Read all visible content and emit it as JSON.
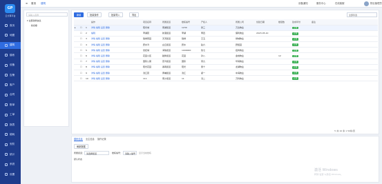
{
  "app": {
    "logo": "GP",
    "logo_text": "云计算平台"
  },
  "nav": [
    "首页",
    "地图",
    "建筑",
    "楼栋",
    "设备",
    "告警",
    "客户",
    "合同",
    "账单",
    "工单",
    "报表",
    "能耗",
    "安防",
    "统计",
    "系统",
    "设置"
  ],
  "nav_active": 2,
  "topbar": {
    "tabs": [
      "首页",
      "建筑"
    ],
    "links": [
      "设备通知",
      "服务中心",
      "在线客服"
    ],
    "user": "物业管理员"
  },
  "tree": {
    "search_placeholder": "请输入名称",
    "nodes": [
      "▾ 全部建筑信息",
      "  · 综合楼"
    ]
  },
  "toolbar": {
    "new": "新增",
    "batch": "批量操作",
    "import": "批量导入",
    "export": "导出",
    "filter": "全部筛选"
  },
  "table": {
    "headers": [
      "",
      "",
      "",
      "操作",
      "项目名称",
      "所属街道",
      "楼栋编号",
      "产权人",
      "所属公司",
      "创建日期",
      "楼层数",
      "建成年份",
      "备注"
    ],
    "rows": [
      {
        "ops": "详情  编辑  设置  删除",
        "name": "阳光城",
        "street": "南湖街道",
        "code": "1230",
        "owner": "张三",
        "company": "万达物业",
        "date": "",
        "floors": "",
        "year": "",
        "status": "正常"
      },
      {
        "ops": "编辑",
        "name": "翠湖苑",
        "street": "新港街道",
        "code": "翠湖",
        "owner": "李四",
        "company": "保利物业",
        "date": "2023-05-10",
        "floors": "",
        "year": "",
        "status": "正常"
      },
      {
        "ops": "详情  编辑  设置  删除",
        "name": "锦绣家园",
        "street": "天河街道",
        "code": "锦绣",
        "owner": "王五",
        "company": "绿城物业",
        "date": "",
        "floors": "",
        "year": "",
        "status": "正常"
      },
      {
        "ops": "详情  编辑  设置  删除",
        "name": "碧水湾",
        "street": "白云街道",
        "code": "碧水",
        "owner": "赵六",
        "company": "碧桂园",
        "date": "",
        "floors": "",
        "year": "",
        "status": "正常"
      },
      {
        "ops": "详情  编辑  设置  删除",
        "name": "世纪城",
        "street": "海珠街道",
        "code": "1000000",
        "owner": "钱七",
        "company": "招商物业",
        "date": "",
        "floors": "",
        "year": "",
        "status": "正常"
      },
      {
        "ops": "详情  编辑  设置  删除",
        "name": "花园小区",
        "street": "越秀街道",
        "code": "花园",
        "owner": "孙八",
        "company": "金地物业",
        "date": "",
        "floors": "12",
        "year": "",
        "status": "正常"
      },
      {
        "ops": "详情  编辑  设置  删除",
        "name": "国际公寓",
        "street": "荔湾街道",
        "code": "国际",
        "owner": "周九",
        "company": "华润物业",
        "date": "",
        "floors": "",
        "year": "",
        "status": "正常"
      },
      {
        "ops": "详情  编辑  设置  删除",
        "name": "阳光花园",
        "street": "番禺街道",
        "code": "阳光",
        "owner": "吴十",
        "company": "龙湖物业",
        "date": "",
        "floors": "",
        "year": "",
        "status": "正常"
      },
      {
        "ops": "详情  编辑  设置  删除",
        "name": "滨江苑",
        "street": "黄埔街道",
        "code": "滨江",
        "owner": "郑一",
        "company": "中海物业",
        "date": "",
        "floors": "",
        "year": "",
        "status": "正常"
      },
      {
        "ops": "详情  编辑  设置  删除",
        "name": "111",
        "street": "南沙街道",
        "code": "11",
        "owner": "冯二",
        "company": "万科物业",
        "date": "",
        "floors": "",
        "year": "",
        "status": "正常"
      }
    ]
  },
  "pager": {
    "total": "共 10 条",
    "page": "1",
    "size": "50条/页"
  },
  "bottom": {
    "tabs": [
      "楼栋信息",
      "业主信息",
      "操作记录"
    ],
    "refresh": "刷新数据",
    "label1": "所属街道：",
    "value1": "请选择街道",
    "label2": "楼栋编号：",
    "value2": "请输入编号",
    "label3": "默认状态",
    "check_label": "显示当前楼栋"
  },
  "watermark": {
    "line1": "激活 Windows",
    "line2": "转到\"设置\"以激活 Windows。"
  }
}
